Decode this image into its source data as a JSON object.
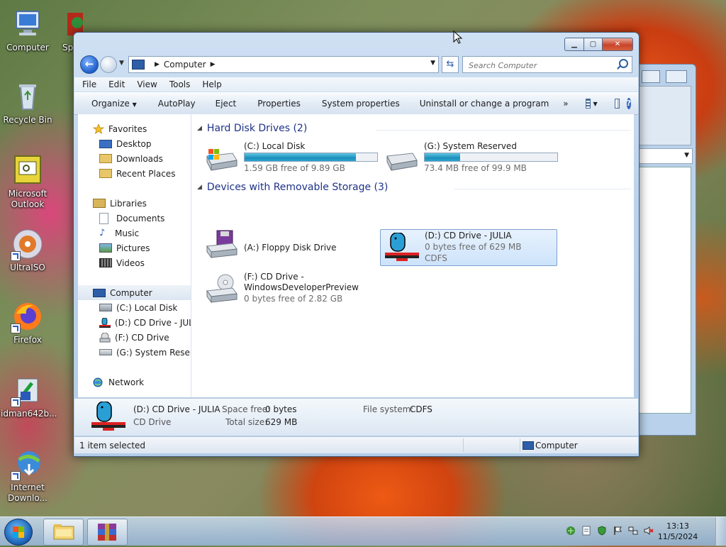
{
  "desktop": {
    "icons": [
      {
        "label": "Computer"
      },
      {
        "label": "Sp"
      },
      {
        "label": "Recycle Bin"
      },
      {
        "label": "Microsoft Outlook"
      },
      {
        "label": "UltraISO"
      },
      {
        "label": "Firefox"
      },
      {
        "label": "idman642b..."
      },
      {
        "label": "Internet Downlo..."
      }
    ]
  },
  "window": {
    "address": {
      "crumb": "Computer"
    },
    "search": {
      "placeholder": "Search Computer"
    },
    "menu": [
      "File",
      "Edit",
      "View",
      "Tools",
      "Help"
    ],
    "commands": {
      "organize": "Organize",
      "autoplay": "AutoPlay",
      "eject": "Eject",
      "properties": "Properties",
      "system_properties": "System properties",
      "uninstall": "Uninstall or change a program",
      "more": "»"
    },
    "nav": {
      "favorites": {
        "label": "Favorites",
        "items": [
          "Desktop",
          "Downloads",
          "Recent Places"
        ]
      },
      "libraries": {
        "label": "Libraries",
        "items": [
          "Documents",
          "Music",
          "Pictures",
          "Videos"
        ]
      },
      "computer": {
        "label": "Computer",
        "items": [
          "(C:) Local Disk",
          "(D:) CD Drive - JULIA",
          "(F:) CD Drive",
          "(G:) System Reserved"
        ]
      },
      "network": {
        "label": "Network"
      }
    },
    "groups": {
      "hdd": "Hard Disk Drives (2)",
      "removable": "Devices with Removable Storage (3)"
    },
    "drives": {
      "c": {
        "name": "(C:) Local Disk",
        "free": "1.59 GB free of 9.89 GB",
        "used_fraction": 0.84
      },
      "g": {
        "name": "(G:) System Reserved",
        "free": "73.4 MB free of 99.9 MB",
        "used_fraction": 0.27
      },
      "a": {
        "name": "(A:) Floppy Disk Drive"
      },
      "d": {
        "name": "(D:) CD Drive - JULIA",
        "free": "0 bytes free of 629 MB",
        "fs": "CDFS"
      },
      "f": {
        "name": "(F:) CD Drive -",
        "name2": "WindowsDeveloperPreview",
        "free": "0 bytes free of 2.82 GB"
      }
    },
    "details": {
      "name": "(D:) CD Drive - JULIA",
      "type": "CD Drive",
      "space_free_label": "Space free:",
      "space_free": "0 bytes",
      "total_size_label": "Total size:",
      "total_size": "629 MB",
      "fs_label": "File system:",
      "fs": "CDFS"
    },
    "status": {
      "left": "1 item selected",
      "right": "Computer"
    }
  },
  "taskbar": {
    "time": "13:13",
    "date": "11/5/2024"
  },
  "colors": {
    "accent": "#1e3287",
    "selection": "#cde3fb",
    "bar_fill": "#1d8fbd"
  }
}
